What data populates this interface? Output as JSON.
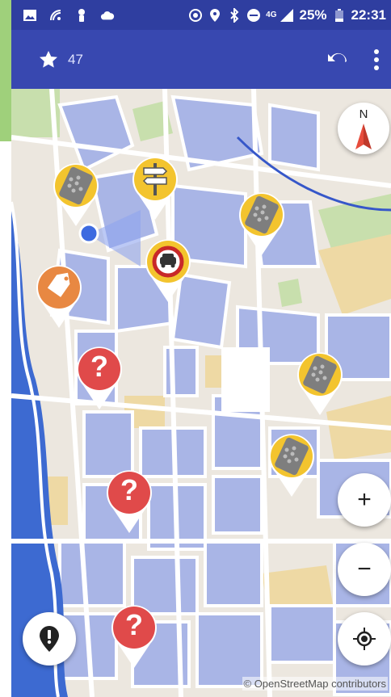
{
  "status_bar": {
    "battery": "25%",
    "time": "22:31",
    "network": "4G",
    "left_icons": [
      "image-icon",
      "signal-hotspot-icon",
      "torch-icon",
      "cloud-icon"
    ],
    "right_icons": [
      "hotspot-icon",
      "location-icon",
      "bluetooth-icon",
      "do-not-disturb-icon",
      "cell-signal-icon",
      "battery-icon"
    ]
  },
  "app_bar": {
    "star_count": "47",
    "icons": {
      "star": "star-icon",
      "undo": "undo-icon",
      "overflow": "more-vert-icon"
    },
    "color": "#3848b0"
  },
  "map": {
    "compass_label": "N",
    "attribution": "© OpenStreetMap contributors",
    "pins": [
      {
        "type": "surface",
        "icon": "cobblestone-icon",
        "accent": "#f3c42e"
      },
      {
        "type": "signpost",
        "icon": "signpost-icon",
        "accent": "#f3c42e"
      },
      {
        "type": "surface",
        "icon": "cobblestone-icon",
        "accent": "#f3c42e"
      },
      {
        "type": "car-restriction",
        "icon": "no-car-icon",
        "accent": "#f3c42e"
      },
      {
        "type": "tag",
        "icon": "tag-icon",
        "accent": "#e88842"
      },
      {
        "type": "question",
        "icon": "question-icon",
        "accent": "#e04a4a",
        "label": "?"
      },
      {
        "type": "surface",
        "icon": "cobblestone-icon",
        "accent": "#f3c42e"
      },
      {
        "type": "surface",
        "icon": "cobblestone-icon",
        "accent": "#f3c42e"
      },
      {
        "type": "question",
        "icon": "question-icon",
        "accent": "#e04a4a",
        "label": "?"
      },
      {
        "type": "question",
        "icon": "question-icon",
        "accent": "#e04a4a",
        "label": "?"
      }
    ],
    "colors": {
      "land": "#ece7df",
      "buildings": "#a9b5e6",
      "water": "#3d6ad1",
      "park": "#c8dfad",
      "roads": "#ffffff"
    }
  },
  "controls": {
    "zoom_in_label": "+",
    "zoom_out_label": "−",
    "zoom_in_icon": "plus-icon",
    "zoom_out_icon": "minus-icon",
    "locate_icon": "my-location-icon",
    "report_icon": "exclamation-marker-icon"
  }
}
